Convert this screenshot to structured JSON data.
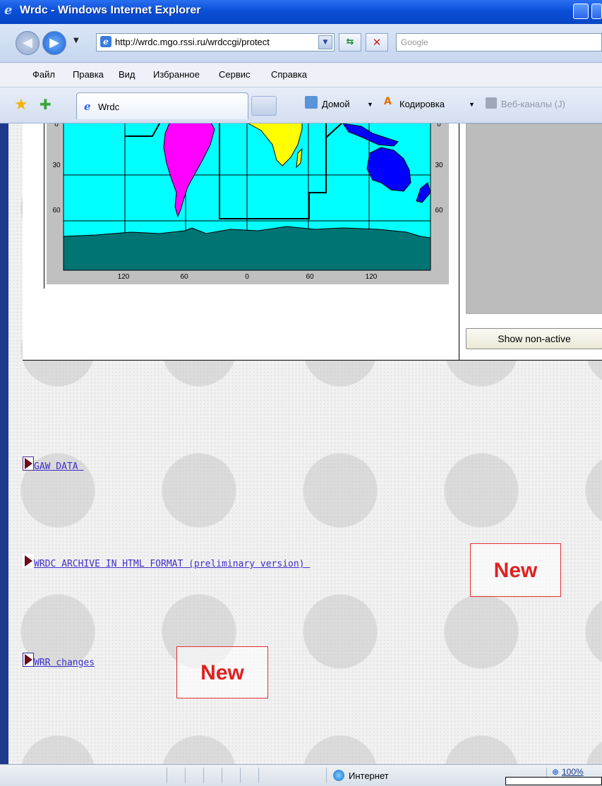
{
  "window": {
    "title": "Wrdc - Windows Internet Explorer"
  },
  "address_bar": {
    "url": "http://wrdc.mgo.rssi.ru/wrdccgi/protect",
    "search_placeholder": "Google"
  },
  "menu": [
    "Файл",
    "Правка",
    "Вид",
    "Избранное",
    "Сервис",
    "Справка"
  ],
  "tab": {
    "label": "Wrdc"
  },
  "command_bar": {
    "home": "Домой",
    "encoding": "Кодировка",
    "feeds": "Веб-каналы (J)"
  },
  "map": {
    "lat_labels": [
      "0",
      "30",
      "60"
    ],
    "lon_labels": [
      "120",
      "60",
      "0",
      "60",
      "120"
    ],
    "colors": {
      "ocean": "#00ffff",
      "south_america": "#ff00ff",
      "africa": "#ffff00",
      "australia": "#0000ff",
      "antarctica": "#007373",
      "frame": "#c0c0c0"
    }
  },
  "side_panel": {
    "button_label": "Show non-active"
  },
  "links": [
    {
      "label": "GAW DATA "
    },
    {
      "label": "WRDC ARCHIVE IN HTML FORMAT (preliminary version) "
    },
    {
      "label": "WRR changes"
    }
  ],
  "badges": {
    "new_label": "New"
  },
  "status_bar": {
    "zone": "Интернет",
    "zoom": "100%"
  },
  "colors": {
    "link": "#3d2fc9",
    "badge": "#e02020",
    "titlebar": "#0a4fd8"
  }
}
